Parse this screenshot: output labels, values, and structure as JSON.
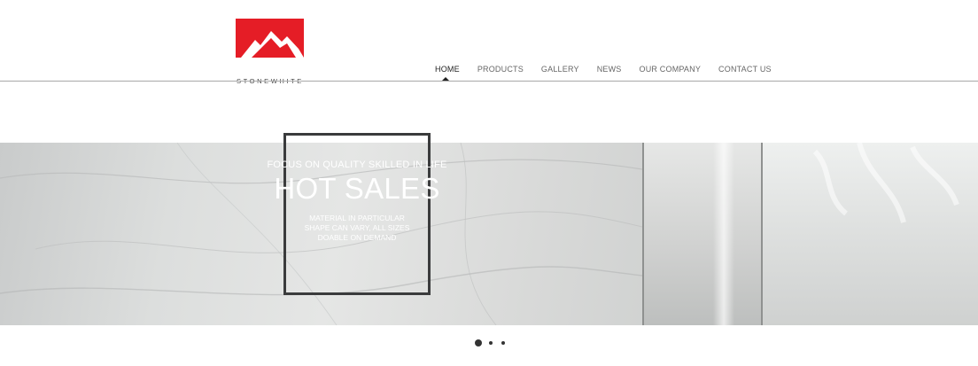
{
  "brand": {
    "name": "STONEWHITE",
    "color": "#e51d26"
  },
  "nav": {
    "items": [
      {
        "label": "HOME",
        "active": true
      },
      {
        "label": "PRODUCTS",
        "active": false
      },
      {
        "label": "GALLERY",
        "active": false
      },
      {
        "label": "NEWS",
        "active": false
      },
      {
        "label": "OUR COMPANY",
        "active": false
      },
      {
        "label": "CONTACT US",
        "active": false
      }
    ]
  },
  "hero": {
    "tagline": "FOCUS ON QUALITY SKILLED IN LIFE",
    "headline": "HOT SALES",
    "lines": [
      "MATERIAL IN PARTICULAR",
      "SHAPE CAN VARY, ALL SIZES",
      "DOABLE ON DEMAND"
    ]
  },
  "slider": {
    "slide_count": 3,
    "active_slide": 1
  }
}
